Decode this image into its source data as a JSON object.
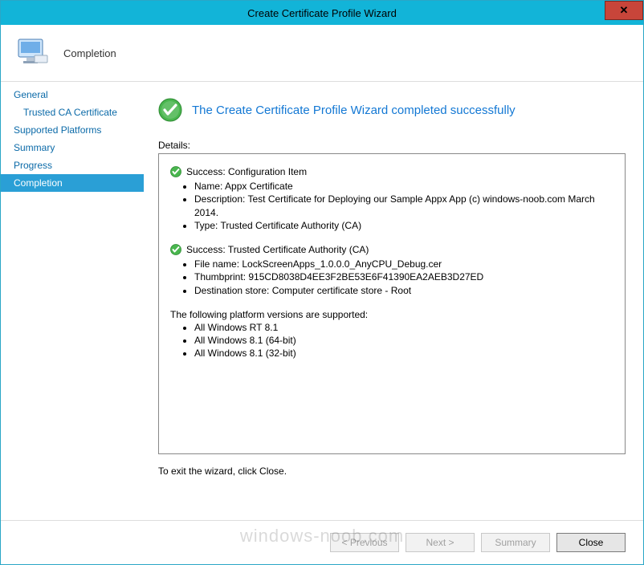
{
  "window": {
    "title": "Create Certificate Profile Wizard",
    "close_glyph": "✕"
  },
  "header": {
    "page_name": "Completion"
  },
  "nav": {
    "items": [
      {
        "label": "General",
        "sub": false,
        "selected": false
      },
      {
        "label": "Trusted CA Certificate",
        "sub": true,
        "selected": false
      },
      {
        "label": "Supported Platforms",
        "sub": false,
        "selected": false
      },
      {
        "label": "Summary",
        "sub": false,
        "selected": false
      },
      {
        "label": "Progress",
        "sub": false,
        "selected": false
      },
      {
        "label": "Completion",
        "sub": false,
        "selected": true
      }
    ]
  },
  "content": {
    "success_message": "The Create Certificate Profile Wizard completed successfully",
    "details_label": "Details:",
    "sections": [
      {
        "heading": "Success: Configuration Item",
        "items": [
          "Name: Appx Certificate",
          "Description: Test Certificate for Deploying our Sample Appx App (c) windows-noob.com March 2014.",
          "Type: Trusted Certificate Authority (CA)"
        ]
      },
      {
        "heading": "Success: Trusted Certificate Authority (CA)",
        "items": [
          "File name: LockScreenApps_1.0.0.0_AnyCPU_Debug.cer",
          "Thumbprint: 915CD8038D4EE3F2BE53E6F41390EA2AEB3D27ED",
          "Destination store: Computer certificate store - Root"
        ]
      }
    ],
    "platforms_intro": "The following platform versions are supported:",
    "platforms": [
      "All Windows RT 8.1",
      "All Windows 8.1 (64-bit)",
      "All Windows 8.1 (32-bit)"
    ],
    "exit_note": "To exit the wizard, click Close."
  },
  "footer": {
    "previous": "< Previous",
    "next": "Next >",
    "summary": "Summary",
    "close": "Close"
  },
  "watermark": "windows-noob.com"
}
